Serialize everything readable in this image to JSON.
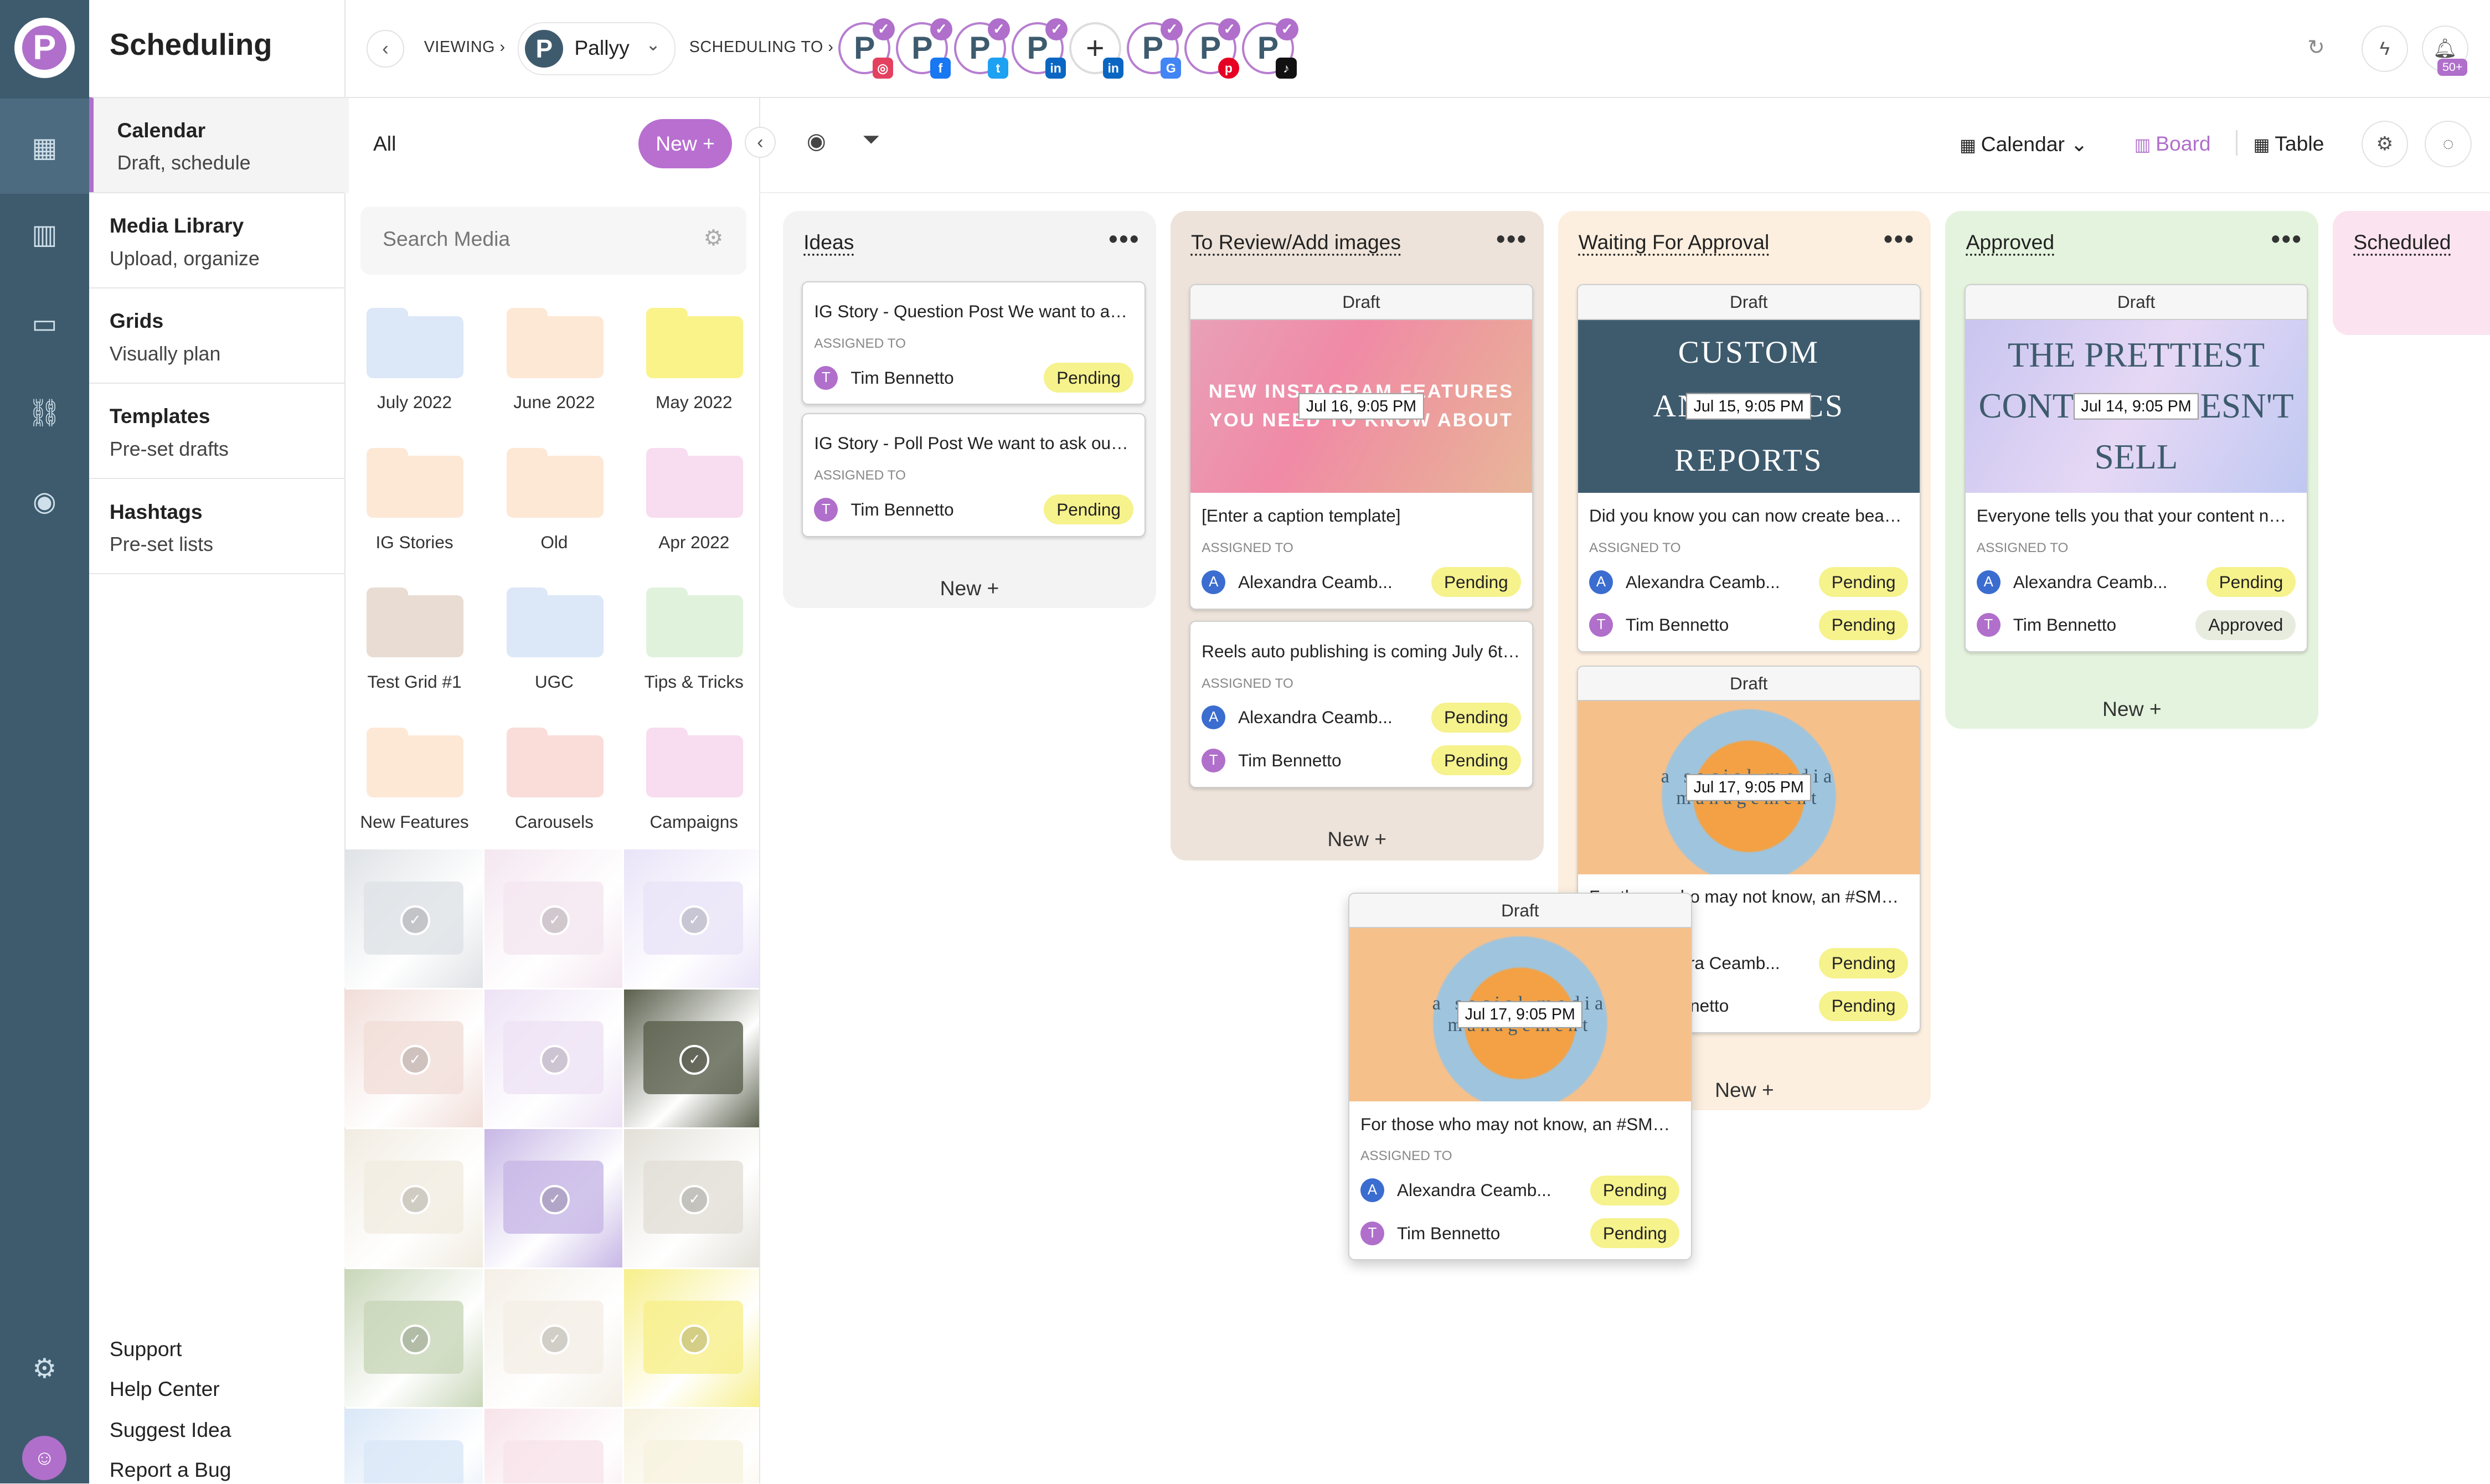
{
  "app": {
    "title": "Scheduling",
    "logo_letter": "P"
  },
  "rail": {
    "icons": [
      "calendar-icon",
      "analytics-icon",
      "comments-icon",
      "link-icon",
      "compass-icon"
    ],
    "bottom_icons": [
      "gear-icon",
      "team-icon"
    ]
  },
  "nav": {
    "items": [
      {
        "title": "Calendar",
        "sub": "Draft, schedule",
        "active": true
      },
      {
        "title": "Media Library",
        "sub": "Upload, organize"
      },
      {
        "title": "Grids",
        "sub": "Visually plan"
      },
      {
        "title": "Templates",
        "sub": "Pre-set drafts"
      },
      {
        "title": "Hashtags",
        "sub": "Pre-set lists"
      }
    ],
    "footer": [
      "Support",
      "Help Center",
      "Suggest Idea",
      "Report a Bug"
    ]
  },
  "topbar": {
    "viewing_label": "VIEWING",
    "brand": "Pallyy",
    "scheduling_label": "SCHEDULING TO",
    "accounts": [
      {
        "network": "instagram",
        "color": "#e4405f",
        "glyph": "◎",
        "checked": true
      },
      {
        "network": "facebook",
        "color": "#1877f2",
        "glyph": "f",
        "checked": true
      },
      {
        "network": "twitter",
        "color": "#1da1f2",
        "glyph": "t",
        "checked": true
      },
      {
        "network": "linkedin",
        "color": "#0a66c2",
        "glyph": "in",
        "checked": true
      },
      {
        "network": "linkedin-add",
        "color": "#0a66c2",
        "glyph": "in",
        "checked": false
      },
      {
        "network": "google-business",
        "color": "#4285f4",
        "glyph": "G",
        "checked": true
      },
      {
        "network": "pinterest",
        "color": "#e60023",
        "glyph": "p",
        "checked": true
      },
      {
        "network": "tiktok",
        "color": "#111111",
        "glyph": "♪",
        "checked": true
      }
    ],
    "notification_badge": "50+"
  },
  "media": {
    "filter": "All",
    "new_label": "New +",
    "search_placeholder": "Search Media",
    "folders": [
      {
        "name": "July 2022",
        "color": "#dce7f7"
      },
      {
        "name": "June 2022",
        "color": "#fde8d6"
      },
      {
        "name": "May 2022",
        "color": "#faf38a"
      },
      {
        "name": "IG Stories",
        "color": "#fde8d6"
      },
      {
        "name": "Old",
        "color": "#fde8d6"
      },
      {
        "name": "Apr 2022",
        "color": "#f8dcf0"
      },
      {
        "name": "Test Grid #1",
        "color": "#e9dcd3"
      },
      {
        "name": "UGC",
        "color": "#dce7f7"
      },
      {
        "name": "Tips & Tricks",
        "color": "#e0f2dc"
      },
      {
        "name": "New Features",
        "color": "#fde8d6"
      },
      {
        "name": "Carousels",
        "color": "#fadcd8"
      },
      {
        "name": "Campaigns",
        "color": "#f8dcf0"
      }
    ],
    "thumb_colors": [
      "#dfe2e6",
      "#f4e6f0",
      "#e9e3f8",
      "#f1ddd8",
      "#ede2f5",
      "#5a5f4c",
      "#f1ece1",
      "#c7b7e6",
      "#e2dfd7",
      "#c8d6b8",
      "#f4efe6",
      "#f7ef8a",
      "#d9e7f7",
      "#f7e3ea",
      "#f7f2df"
    ]
  },
  "board": {
    "view_calendar": "Calendar",
    "view_board": "Board",
    "view_table": "Table",
    "accent": "#b06fcb",
    "columns": [
      {
        "title": "Ideas",
        "bg": "#f3f3f3",
        "new_label": "New +",
        "cards": [
          {
            "caption": "IG Story - Question Post We want to ask ...",
            "assignees": [
              {
                "initial": "T",
                "name": "Tim Bennetto",
                "status": "Pending"
              }
            ]
          },
          {
            "caption": "IG Story - Poll Post We want to ask our fo...",
            "assignees": [
              {
                "initial": "T",
                "name": "Tim Bennetto",
                "status": "Pending"
              }
            ]
          }
        ]
      },
      {
        "title": "To Review/Add images",
        "bg": "#ede3da",
        "new_label": "New +",
        "cards": [
          {
            "draft": "Draft",
            "image": "pink",
            "image_text": "NEW INSTAGRAM FEATURES YOU NEED TO KNOW ABOUT",
            "time": "Jul 16, 9:05 PM",
            "caption": "[Enter a caption template]",
            "assignees": [
              {
                "initial": "A",
                "name": "Alexandra Ceamb...",
                "status": "Pending"
              }
            ]
          },
          {
            "caption": "Reels auto publishing is coming July 6th...",
            "assignees": [
              {
                "initial": "A",
                "name": "Alexandra Ceamb...",
                "status": "Pending"
              },
              {
                "initial": "T",
                "name": "Tim Bennetto",
                "status": "Pending"
              }
            ]
          }
        ]
      },
      {
        "title": "Waiting For Approval",
        "bg": "#fcefdf",
        "new_label": "New +",
        "cards": [
          {
            "draft": "Draft",
            "image": "teal",
            "image_text": "CUSTOM ANALYTICS REPORTS",
            "time": "Jul 15, 9:05 PM",
            "caption": "Did you know you can now create beauti...",
            "assignees": [
              {
                "initial": "A",
                "name": "Alexandra Ceamb...",
                "status": "Pending"
              },
              {
                "initial": "T",
                "name": "Tim Bennetto",
                "status": "Pending"
              }
            ]
          },
          {
            "draft": "Draft",
            "image": "orange",
            "image_text": "a social media management",
            "time": "Jul 17, 9:05 PM",
            "caption": "For those who may not know, an #SMMt...",
            "assignees": [
              {
                "initial": "A",
                "name": "Alexandra Ceamb...",
                "status": "Pending"
              },
              {
                "initial": "T",
                "name": "Tim Bennetto",
                "status": "Pending"
              }
            ]
          }
        ]
      },
      {
        "title": "Approved",
        "bg": "#e4f3dd",
        "new_label": "New +",
        "cards": [
          {
            "draft": "Draft",
            "image": "lavender",
            "image_text": "THE PRETTIEST CONTENT DOESN'T SELL",
            "time": "Jul 14, 9:05 PM",
            "caption": "Everyone tells you that your content nee...",
            "assignees": [
              {
                "initial": "A",
                "name": "Alexandra Ceamb...",
                "status": "Pending"
              },
              {
                "initial": "T",
                "name": "Tim Bennetto",
                "status": "Approved"
              }
            ]
          }
        ]
      },
      {
        "title": "Scheduled",
        "bg": "#fbe3ef",
        "cards": []
      }
    ],
    "dragging_card": {
      "draft": "Draft",
      "image": "orange",
      "image_text": "a social media management",
      "time": "Jul 17, 9:05 PM",
      "caption": "For those who may not know, an #SMMt...",
      "assignees": [
        {
          "initial": "A",
          "name": "Alexandra Ceamb...",
          "status": "Pending"
        },
        {
          "initial": "T",
          "name": "Tim Bennetto",
          "status": "Pending"
        }
      ]
    }
  },
  "colors": {
    "rail": "#3e5b6e",
    "pending": "#f6f28c",
    "approved": "#e7ecdf",
    "avatar_T": "#b06fcb",
    "avatar_A": "#3b6dd0"
  }
}
